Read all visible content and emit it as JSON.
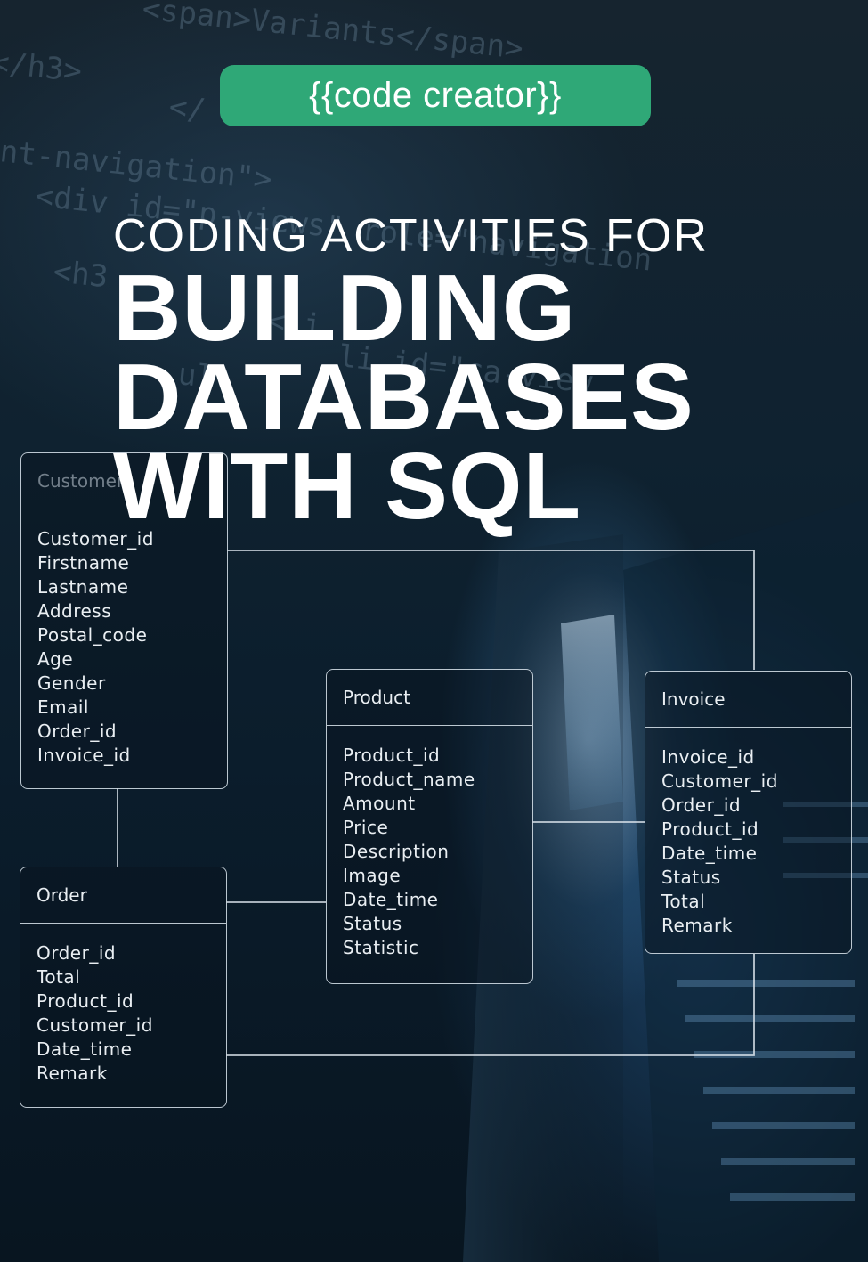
{
  "badge": {
    "label": "{{code creator}}"
  },
  "title": {
    "line1": "CODING ACTIVITIES FOR",
    "line2": "BUILDING",
    "line3": "DATABASES",
    "line4": "WITH SQL"
  },
  "background_code": [
    "<span>Variants</span>",
    "</h3>",
    "</",
    "nt-navigation\">",
    "<div id=\"p-views\" role=\"navigation",
    "<h3",
    "<li",
    "ul",
    "li id=\"ca-view"
  ],
  "tables": {
    "customer": {
      "name": "Customer",
      "fields": [
        "Customer_id",
        "Firstname",
        "Lastname",
        "Address",
        "Postal_code",
        "Age",
        "Gender",
        "Email",
        "Order_id",
        "Invoice_id"
      ]
    },
    "order": {
      "name": "Order",
      "fields": [
        "Order_id",
        "Total",
        "Product_id",
        "Customer_id",
        "Date_time",
        "Remark"
      ]
    },
    "product": {
      "name": "Product",
      "fields": [
        "Product_id",
        "Product_name",
        "Amount",
        "Price",
        "Description",
        "Image",
        "Date_time",
        "Status",
        "Statistic"
      ]
    },
    "invoice": {
      "name": "Invoice",
      "fields": [
        "Invoice_id",
        "Customer_id",
        "Order_id",
        "Product_id",
        "Date_time",
        "Status",
        "Total",
        "Remark"
      ]
    }
  },
  "colors": {
    "badge": "#2fa877",
    "title": "#ffffff",
    "background": "#0b1a26",
    "lines": "#dfe7ee"
  }
}
